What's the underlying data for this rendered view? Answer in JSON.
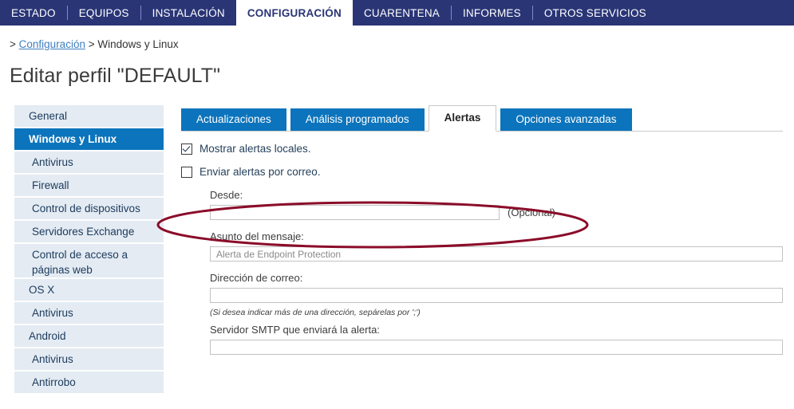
{
  "topnav": {
    "items": [
      {
        "label": "ESTADO",
        "active": false
      },
      {
        "label": "EQUIPOS",
        "active": false
      },
      {
        "label": "INSTALACIÓN",
        "active": false
      },
      {
        "label": "CONFIGURACIÓN",
        "active": true
      },
      {
        "label": "CUARENTENA",
        "active": false
      },
      {
        "label": "INFORMES",
        "active": false
      },
      {
        "label": "OTROS SERVICIOS",
        "active": false
      }
    ]
  },
  "breadcrumb": {
    "prefix": ">",
    "link": "Configuración",
    "separator": ">",
    "current": "Windows y Linux"
  },
  "page": {
    "title": "Editar perfil \"DEFAULT\""
  },
  "sidebar": {
    "items": [
      {
        "label": "General"
      },
      {
        "label": "Windows y Linux"
      },
      {
        "label": "Antivirus"
      },
      {
        "label": "Firewall"
      },
      {
        "label": "Control de dispositivos"
      },
      {
        "label": "Servidores Exchange"
      },
      {
        "label": "Control de acceso a páginas web"
      },
      {
        "label": "OS X"
      },
      {
        "label": "Antivirus"
      },
      {
        "label": "Android"
      },
      {
        "label": "Antivirus"
      },
      {
        "label": "Antirrobo"
      }
    ]
  },
  "tabs": [
    {
      "label": "Actualizaciones",
      "active": false
    },
    {
      "label": "Análisis programados",
      "active": false
    },
    {
      "label": "Alertas",
      "active": true
    },
    {
      "label": "Opciones avanzadas",
      "active": false
    }
  ],
  "form": {
    "show_local_alerts": {
      "label": "Mostrar alertas locales.",
      "checked": true
    },
    "send_mail_alerts": {
      "label": "Enviar alertas por correo.",
      "checked": false
    },
    "from": {
      "label": "Desde:",
      "value": "",
      "placeholder": "",
      "note": "(Opcional)"
    },
    "subject": {
      "label": "Asunto del mensaje:",
      "value": "Alerta de Endpoint Protection",
      "placeholder": "Alerta de Endpoint Protection"
    },
    "email": {
      "label": "Dirección de correo:",
      "value": "",
      "placeholder": "",
      "hint": "(Si desea indicar más de una dirección, sepárelas por ';')"
    },
    "smtp": {
      "label": "Servidor SMTP que enviará la alerta:",
      "value": "",
      "placeholder": ""
    }
  },
  "annotation": {
    "shape": "ellipse",
    "color": "#8b0c2a",
    "stroke_width": 3
  },
  "colors": {
    "navbar": "#2a3576",
    "accent_blue": "#0b74bc",
    "sidebar_bg": "#e4ebf3",
    "link": "#3f7fc1",
    "annotation_red": "#8b0c2a"
  }
}
